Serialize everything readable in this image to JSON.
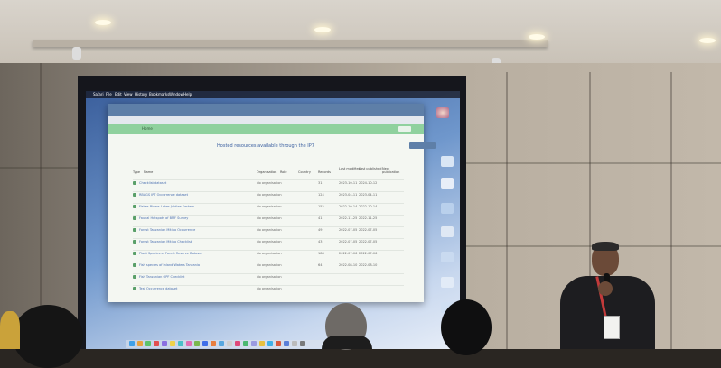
{
  "scene": {
    "description_tag": "photo-of-presentation",
    "accent_colors": {
      "green_header": "#8fd19e",
      "link_blue": "#4a6fb0",
      "wall": "#b7ad9f"
    }
  },
  "slide": {
    "title": "Hosted resources available through the IP7",
    "headers": [
      "Type",
      "Name",
      "Organisation",
      "Role",
      "Country",
      "Records",
      "Last modified",
      "Last published",
      "Next publication"
    ],
    "rows": [
      {
        "name": "Checklist dataset",
        "org": "No organisation",
        "role": "Occurrence",
        "country": "Tanzania",
        "records": "31",
        "modified": "2023-10-11",
        "published": "2024-10-12",
        "next": ""
      },
      {
        "name": "RBAGS IPT Occurrence dataset",
        "org": "No organisation",
        "role": "Occurrence",
        "country": "",
        "records": "124",
        "modified": "2023-04-11",
        "published": "2023-04-11",
        "next": "2023-04-11"
      },
      {
        "name": "Fishes Rivers Lakes Jubilee Eastern",
        "org": "No organisation",
        "role": "Occurrence",
        "country": "Tanzania",
        "records": "152",
        "modified": "2022-10-14",
        "published": "2022-10-14",
        "next": ""
      },
      {
        "name": "Faunal Hotspots of BMF Survey",
        "org": "No organisation",
        "role": "Checklist",
        "country": "",
        "records": "41",
        "modified": "2022-11-25",
        "published": "2022-11-25",
        "next": "2022-11-25"
      },
      {
        "name": "Forest Tanzanian Mitipo Occurrence",
        "org": "No organisation",
        "role": "Occurrence",
        "country": "",
        "records": "49",
        "modified": "2022-07-05",
        "published": "2022-07-05",
        "next": "2022-07-05"
      },
      {
        "name": "Forest Tanzanian Mitipo Checklist",
        "org": "No organisation",
        "role": "Checklist",
        "country": "",
        "records": "43",
        "modified": "2022-07-05",
        "published": "2022-07-05",
        "next": ""
      },
      {
        "name": "Plant Species of Forest Reserve Dataset",
        "org": "No organisation",
        "role": "Occurrence",
        "country": "",
        "records": "188",
        "modified": "2022-07-06",
        "published": "2022-07-06",
        "next": "2022-07-06"
      },
      {
        "name": "Fish species of Inland Waters Tanzania",
        "org": "No organisation",
        "role": "Occurrence",
        "country": "",
        "records": "64",
        "modified": "2022-08-10",
        "published": "2022-08-10",
        "next": "2022-08-10"
      },
      {
        "name": "Fish Tanzanian OPF Checklist",
        "org": "No organisation",
        "role": "Checklist",
        "country": "",
        "records": "",
        "modified": "",
        "published": "",
        "next": ""
      },
      {
        "name": "Test Occurrence dataset",
        "org": "No organisation",
        "role": "Occurrence",
        "country": "",
        "records": "",
        "modified": "",
        "published": "",
        "next": ""
      }
    ],
    "menubar": [
      "Safari",
      "File",
      "Edit",
      "View",
      "History",
      "Bookmarks",
      "Window",
      "Help"
    ],
    "app_nav": "Home"
  }
}
